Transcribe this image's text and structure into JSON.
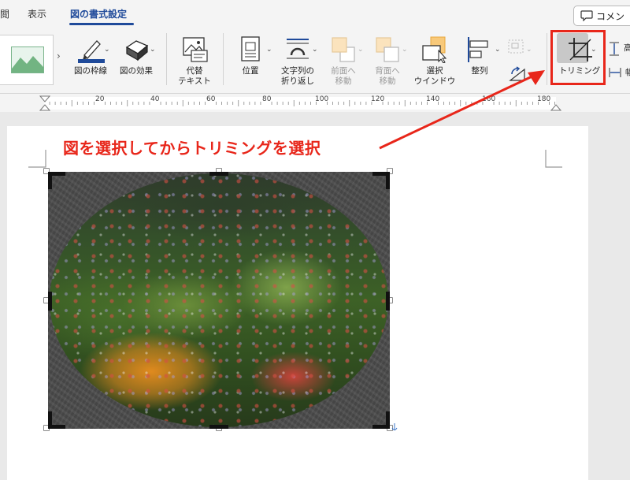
{
  "tabs": [
    {
      "label": "閲"
    },
    {
      "label": "表示"
    },
    {
      "label": "図の書式設定"
    }
  ],
  "comment_button": {
    "label": "コメン"
  },
  "ribbon": {
    "border_label": "図の枠線",
    "effect_label": "図の効果",
    "alt_text_line1": "代替",
    "alt_text_line2": "テキスト",
    "position_label": "位置",
    "wrap_line1": "文字列の",
    "wrap_line2": "折り返し",
    "forward_line1": "前面へ",
    "forward_line2": "移動",
    "backward_line1": "背面へ",
    "backward_line2": "移動",
    "selection_line1": "選択",
    "selection_line2": "ウインドウ",
    "align_label": "整列",
    "crop_label": "トリミング",
    "height_label": "高",
    "width_label": "幅"
  },
  "ruler": {
    "numbers": [
      "20",
      "40",
      "60",
      "80",
      "100",
      "120",
      "140",
      "160",
      "180"
    ]
  },
  "annotation": {
    "text": "図を選択してからトリミングを選択"
  },
  "colors": {
    "accent": "#1f4a9a",
    "highlight": "#e8261a"
  }
}
